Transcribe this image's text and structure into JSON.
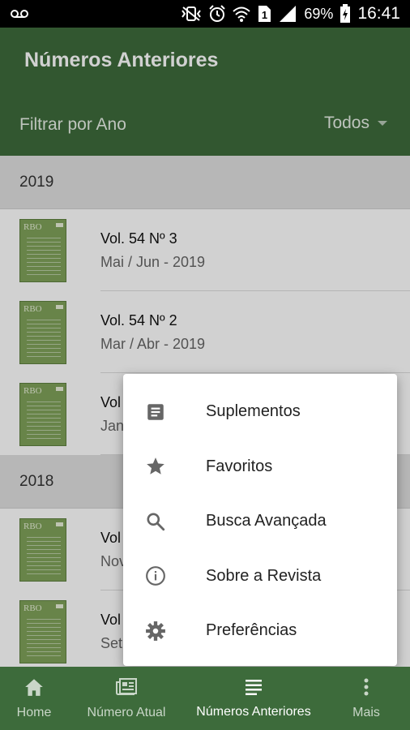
{
  "status_bar": {
    "battery": "69%",
    "time": "16:41",
    "sim_slot": "1",
    "icons": [
      "voicemail-icon",
      "vibrate-off-icon",
      "alarm-icon",
      "wifi-icon",
      "sim-icon",
      "signal-icon",
      "battery-charging-icon"
    ]
  },
  "app_bar": {
    "title": "Números Anteriores",
    "filter_label": "Filtrar por Ano",
    "filter_value": "Todos"
  },
  "years": [
    {
      "year": "2019",
      "issues": [
        {
          "title": "Vol. 54 Nº 3",
          "subtitle": "Mai / Jun - 2019"
        },
        {
          "title": "Vol. 54 Nº 2",
          "subtitle": "Mar / Abr - 2019"
        },
        {
          "title": "Vol",
          "subtitle": "Jan"
        }
      ]
    },
    {
      "year": "2018",
      "issues": [
        {
          "title": "Vol",
          "subtitle": "Nov"
        },
        {
          "title": "Vol",
          "subtitle": "Set"
        }
      ]
    }
  ],
  "cover_label": "RBO",
  "menu": {
    "items": [
      {
        "label": "Suplementos",
        "icon": "article-icon"
      },
      {
        "label": "Favoritos",
        "icon": "star-icon"
      },
      {
        "label": "Busca Avançada",
        "icon": "search-icon"
      },
      {
        "label": "Sobre a Revista",
        "icon": "info-icon"
      },
      {
        "label": "Preferências",
        "icon": "gear-icon"
      }
    ]
  },
  "bottom_nav": {
    "items": [
      {
        "label": "Home",
        "icon": "home-icon"
      },
      {
        "label": "Número Atual",
        "icon": "newspaper-icon"
      },
      {
        "label": "Números Anteriores",
        "icon": "list-icon",
        "active": true
      },
      {
        "label": "Mais",
        "icon": "more-vert-icon"
      }
    ]
  },
  "colors": {
    "primary": "#3d6b3b",
    "cover": "#7fa25a",
    "nav_inactive": "#c9d6c8"
  }
}
